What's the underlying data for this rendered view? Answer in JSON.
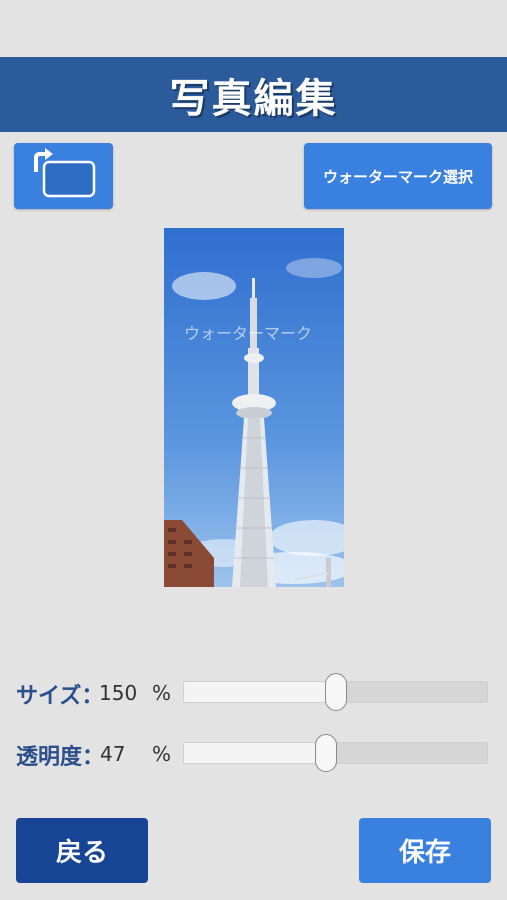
{
  "header": {
    "title": "写真編集"
  },
  "toolbar": {
    "rotate_icon": "rotate-icon",
    "watermark_select_label": "ウォーターマーク選択"
  },
  "preview": {
    "watermark_text": "ウォーターマーク"
  },
  "sliders": {
    "size": {
      "label": "サイズ：",
      "value": "150",
      "unit": "%",
      "fraction": 0.5
    },
    "opacity": {
      "label": "透明度：",
      "value": "47",
      "unit": "%",
      "fraction": 0.47
    }
  },
  "footer": {
    "back_label": "戻る",
    "save_label": "保存"
  },
  "colors": {
    "header": "#2b5b9b",
    "accent": "#3a80de",
    "back": "#174494"
  }
}
